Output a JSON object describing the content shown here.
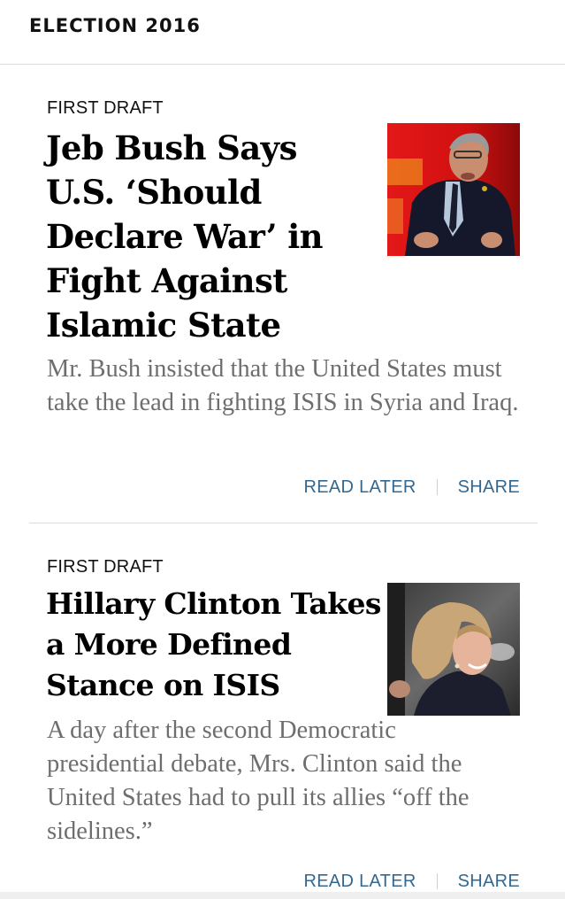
{
  "section": {
    "title": "ELECTION 2016"
  },
  "stories": [
    {
      "kicker": "FIRST DRAFT",
      "headline": "Jeb Bush Says U.S. ‘Should Declare War’ in Fight Against Islamic State",
      "summary": "Mr. Bush insisted that the United States must take the lead in fighting ISIS in Syria and Iraq.",
      "read_later": "READ LATER",
      "share": "SHARE"
    },
    {
      "kicker": "FIRST DRAFT",
      "headline": "Hillary Clinton Takes a More Defined Stance on ISIS",
      "summary": "A day after the second Democratic presidential debate, Mrs. Clinton said the United States had to pull its allies “off the sidelines.”",
      "read_later": "READ LATER",
      "share": "SHARE"
    }
  ],
  "colors": {
    "link": "#326891",
    "summary_text": "#6e6e6e",
    "divider": "#dcdcdc"
  }
}
